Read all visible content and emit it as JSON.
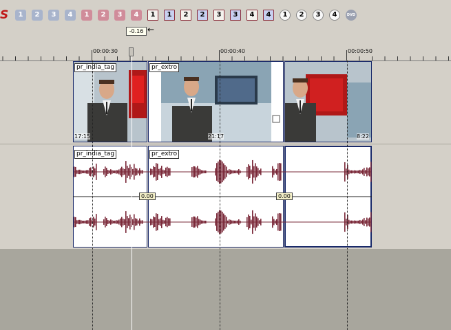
{
  "toolbar": {
    "markers_blue": [
      "1",
      "2",
      "3",
      "4"
    ],
    "markers_red": [
      "1",
      "2",
      "3",
      "4"
    ],
    "region_markers": [
      "1",
      "1",
      "2",
      "2",
      "3",
      "3",
      "4",
      "4"
    ],
    "cd_markers": [
      "1",
      "2",
      "3",
      "4"
    ],
    "dvd_label": "DVD"
  },
  "cursor": {
    "value": "-0.16",
    "arrow": "←"
  },
  "ruler": {
    "labels": [
      "00:00:30",
      "00:00:40",
      "00:00:50"
    ]
  },
  "video_events": [
    {
      "name": "pr_india_tag",
      "timecode": "17:15"
    },
    {
      "name": "pr_extro",
      "timecode": "21:17"
    },
    {
      "name": "",
      "timecode": "8:22"
    }
  ],
  "audio_events": [
    {
      "name": "pr_india_tag"
    },
    {
      "name": "pr_extro"
    }
  ],
  "audio_volume_labels": [
    "0.00",
    "0.00"
  ],
  "colors": {
    "waveform": "#7a2838",
    "event_border": "#1a2a6a",
    "background": "#d4d0c8"
  }
}
